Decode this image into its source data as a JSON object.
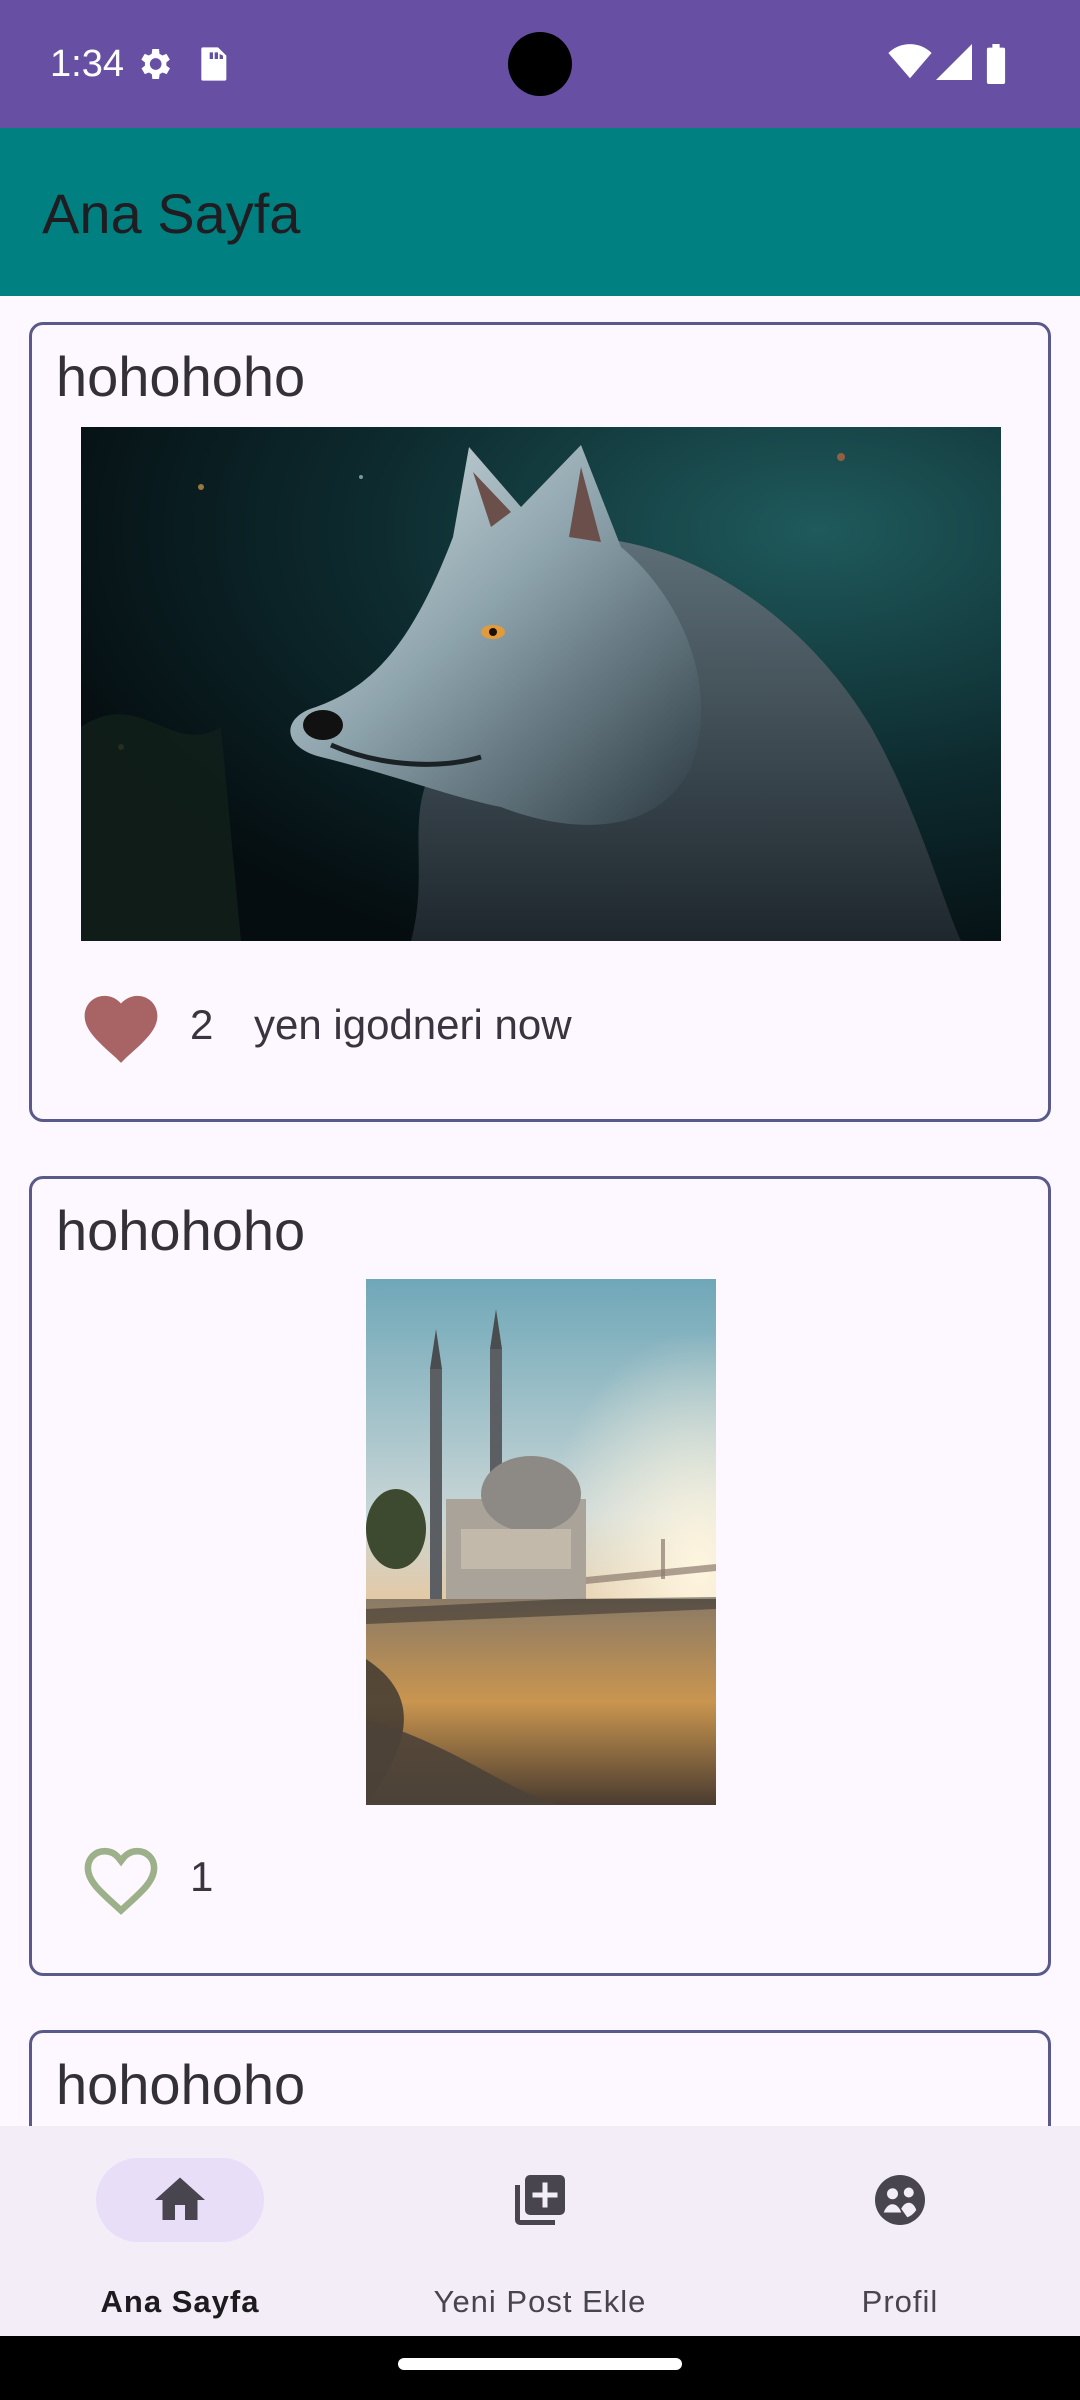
{
  "status_bar": {
    "time": "1:34",
    "icons": [
      "settings-icon",
      "sd-card-icon",
      "wifi-icon",
      "signal-icon",
      "battery-icon"
    ]
  },
  "app_bar": {
    "title": "Ana Sayfa"
  },
  "posts": [
    {
      "title": "hohohoho",
      "image": "wolf-photo",
      "liked": true,
      "like_count": "2",
      "comment": "yen igodneri now"
    },
    {
      "title": "hohohoho",
      "image": "mosque-photo",
      "liked": false,
      "like_count": "1",
      "comment": ""
    },
    {
      "title": "hohohoho"
    }
  ],
  "bottom_nav": {
    "items": [
      {
        "label": "Ana Sayfa",
        "icon": "home-icon",
        "active": true
      },
      {
        "label": "Yeni Post Ekle",
        "icon": "add-post-icon",
        "active": false
      },
      {
        "label": "Profil",
        "icon": "profile-icon",
        "active": false
      }
    ]
  },
  "colors": {
    "status_bar": "#6750A4",
    "app_bar": "#008080",
    "background": "#FDF7FF",
    "card_border": "#5A5A8A",
    "liked_heart": "#A86464",
    "unliked_heart": "#9CB08A",
    "nav_background": "#F3EDF7",
    "nav_indicator": "#E8DEF8"
  }
}
